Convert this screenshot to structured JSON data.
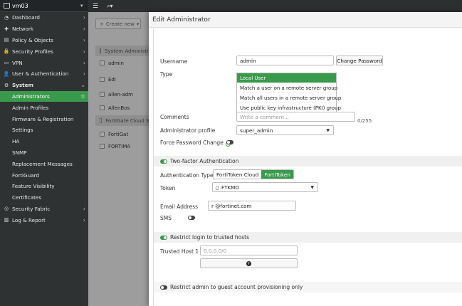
{
  "device": {
    "name": "vm03"
  },
  "sidebar": {
    "items": [
      {
        "label": "Dashboard",
        "icon": "dashboard-icon",
        "glyph": "◔"
      },
      {
        "label": "Network",
        "icon": "network-icon",
        "glyph": "✚"
      },
      {
        "label": "Policy & Objects",
        "icon": "policy-icon",
        "glyph": "▤"
      },
      {
        "label": "Security Profiles",
        "icon": "lock-icon",
        "glyph": "🔒"
      },
      {
        "label": "VPN",
        "icon": "monitor-icon",
        "glyph": "▭"
      },
      {
        "label": "User & Authentication",
        "icon": "user-icon",
        "glyph": "👤"
      },
      {
        "label": "System",
        "icon": "gear-icon",
        "glyph": "⚙"
      }
    ],
    "system_sub": [
      "Administrators",
      "Admin Profiles",
      "Firmware & Registration",
      "Settings",
      "HA",
      "SNMP",
      "Replacement Messages",
      "FortiGuard",
      "Feature Visibility",
      "Certificates"
    ],
    "bottom_items": [
      {
        "label": "Security Fabric",
        "icon": "fabric-icon",
        "glyph": "◎"
      },
      {
        "label": "Log & Report",
        "icon": "chart-icon",
        "glyph": "▥"
      }
    ]
  },
  "background": {
    "create_new": "Create new",
    "rows": [
      {
        "text": "System Administrat",
        "group": true
      },
      {
        "text": "admin",
        "group": false
      },
      {
        "text": "Edi",
        "group": false
      },
      {
        "text": "allen-adm",
        "group": false
      },
      {
        "text": "AllenBos",
        "group": false
      },
      {
        "text": "FortiGate Cloud SS",
        "group": true
      },
      {
        "text": "FortiGat",
        "group": false
      },
      {
        "text": "FORTIMA",
        "group": false
      }
    ]
  },
  "dialog": {
    "title": "Edit Administrator",
    "username_label": "Username",
    "username_value": "admin",
    "change_password": "Change Password",
    "type_label": "Type",
    "type_options": [
      "Local User",
      "Match a user on a remote server group",
      "Match all users in a remote server group",
      "Use public key infrastructure (PKI) group"
    ],
    "comments_label": "Comments",
    "comments_placeholder": "Write a comment...",
    "comments_counter": "0/255",
    "profile_label": "Administrator profile",
    "profile_value": "super_admin",
    "force_pw_label": "Force Password Change",
    "twofa_label": "Two-factor Authentication",
    "auth_type_label": "Authentication Type",
    "auth_types": [
      "FortiToken Cloud",
      "FortiToken"
    ],
    "token_label": "Token",
    "token_value": "FTKMO",
    "email_label": "Email Address",
    "email_value": "r                @fortinet.com",
    "sms_label": "SMS",
    "trusted_label": "Restrict login to trusted hosts",
    "trusted_host_label": "Trusted Host 1",
    "trusted_host_placeholder": "0.0.0.0/0",
    "guest_label": "Restrict admin to guest account provisioning only"
  },
  "colors": {
    "accent": "#3a9a4c",
    "sidebar": "#2e3233"
  }
}
